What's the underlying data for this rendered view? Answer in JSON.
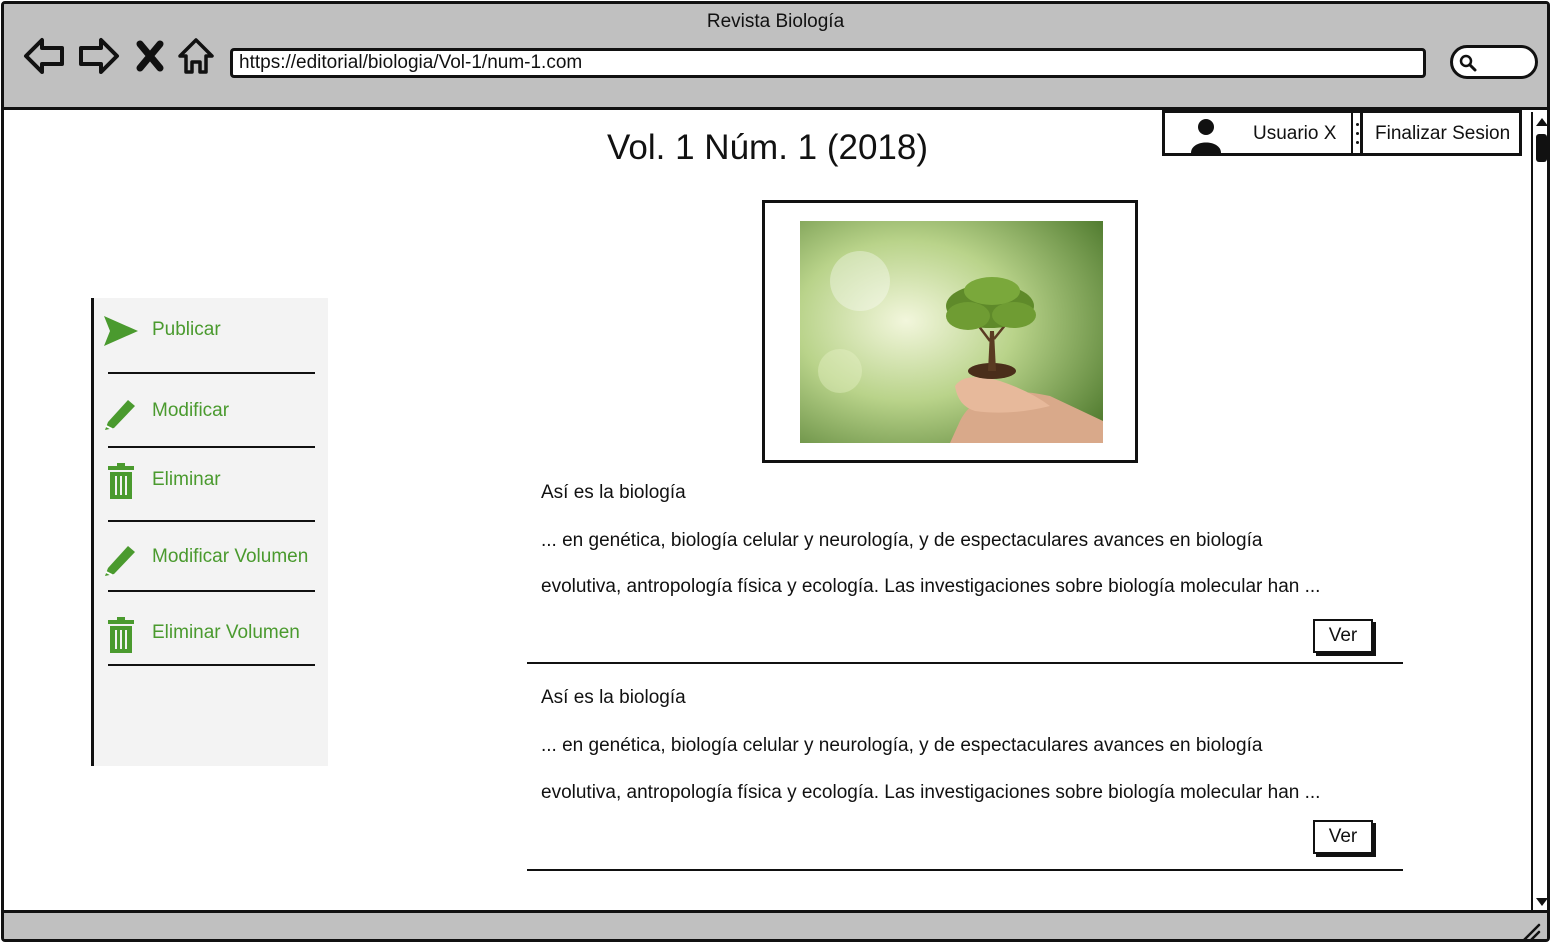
{
  "window": {
    "title": "Revista Biología"
  },
  "browser": {
    "url": "https://editorial/biologia/Vol-1/num-1.com",
    "nav_icons": [
      "back-icon",
      "forward-icon",
      "close-icon",
      "home-icon",
      "search-icon"
    ]
  },
  "user": {
    "name": "Usuario X",
    "logout_label": "Finalizar Sesion",
    "icon": "user-icon"
  },
  "page": {
    "title": "Vol. 1 Núm. 1 (2018)"
  },
  "sidebar": {
    "items": [
      {
        "label": "Publicar",
        "icon": "send-icon"
      },
      {
        "label": "Modificar",
        "icon": "pencil-icon"
      },
      {
        "label": "Eliminar",
        "icon": "trash-icon"
      },
      {
        "label": "Modificar Volumen",
        "icon": "pencil-icon"
      },
      {
        "label": "Eliminar Volumen",
        "icon": "trash-icon"
      }
    ]
  },
  "cover": {
    "image": "tree-in-hands-image"
  },
  "articles": [
    {
      "title": "Así es la biología",
      "line1": "... en genética, biología celular y neurología, y de espectaculares avances en biología",
      "line2": "evolutiva, antropología física y ecología. Las investigaciones sobre biología molecular han ...",
      "button": "Ver"
    },
    {
      "title": "Así es la biología",
      "line1": "... en genética, biología celular y neurología, y de espectaculares avances en biología",
      "line2": "evolutiva, antropología física y ecología. Las investigaciones sobre biología molecular han ...",
      "button": "Ver"
    }
  ],
  "colors": {
    "accent_green": "#4a9a2e",
    "chrome_gray": "#c0c0c0",
    "sidebar_bg": "#f3f3f3"
  }
}
